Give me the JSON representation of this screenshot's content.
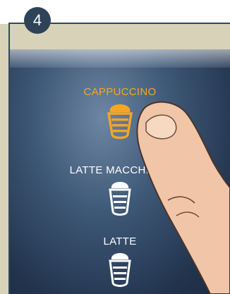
{
  "step": {
    "number": "4"
  },
  "colors": {
    "selected": "#f5a623",
    "unselected": "#ffffff",
    "badge": "#2e4258",
    "frame": "#d8d3b8"
  },
  "drinks": [
    {
      "label": "CAPPUCCINO",
      "selected": true,
      "icon": "cappuccino-cup-icon"
    },
    {
      "label": "LATTE MACCHIATO",
      "selected": false,
      "icon": "latte-macchiato-glass-icon"
    },
    {
      "label": "LATTE",
      "selected": false,
      "icon": "latte-glass-icon"
    }
  ],
  "pointer": {
    "icon": "finger-pointer-icon"
  }
}
